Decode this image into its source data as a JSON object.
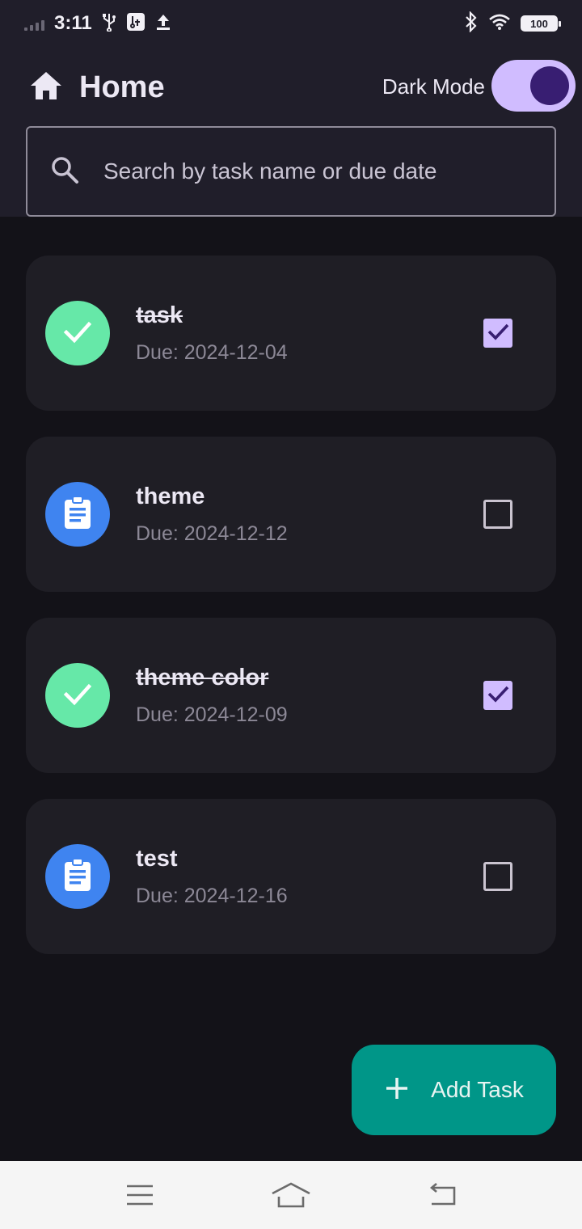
{
  "status_bar": {
    "time": "3:11",
    "battery": "100",
    "icons": [
      "signal-icon",
      "usb-icon",
      "usb-debug-icon",
      "upload-icon",
      "bluetooth-icon",
      "wifi-icon",
      "battery-icon"
    ]
  },
  "header": {
    "title": "Home",
    "icon": "home-icon",
    "dark_mode_label": "Dark Mode",
    "dark_mode_on": true
  },
  "search": {
    "placeholder": "Search by task name or due date",
    "value": ""
  },
  "tasks": [
    {
      "name": "task",
      "due": "Due: 2024-12-04",
      "completed": true,
      "icon": "check-icon"
    },
    {
      "name": "theme",
      "due": "Due: 2024-12-12",
      "completed": false,
      "icon": "clipboard-icon"
    },
    {
      "name": "theme color",
      "due": "Due: 2024-12-09",
      "completed": true,
      "icon": "check-icon"
    },
    {
      "name": "test",
      "due": "Due: 2024-12-16",
      "completed": false,
      "icon": "clipboard-icon"
    }
  ],
  "fab": {
    "label": "Add Task",
    "icon": "plus-icon"
  },
  "nav": {
    "items": [
      "menu-icon",
      "home-nav-icon",
      "back-icon"
    ]
  },
  "colors": {
    "accent": "#d0bcff",
    "completed": "#66e8a8",
    "pending": "#3f84f0",
    "fab": "#009688"
  }
}
